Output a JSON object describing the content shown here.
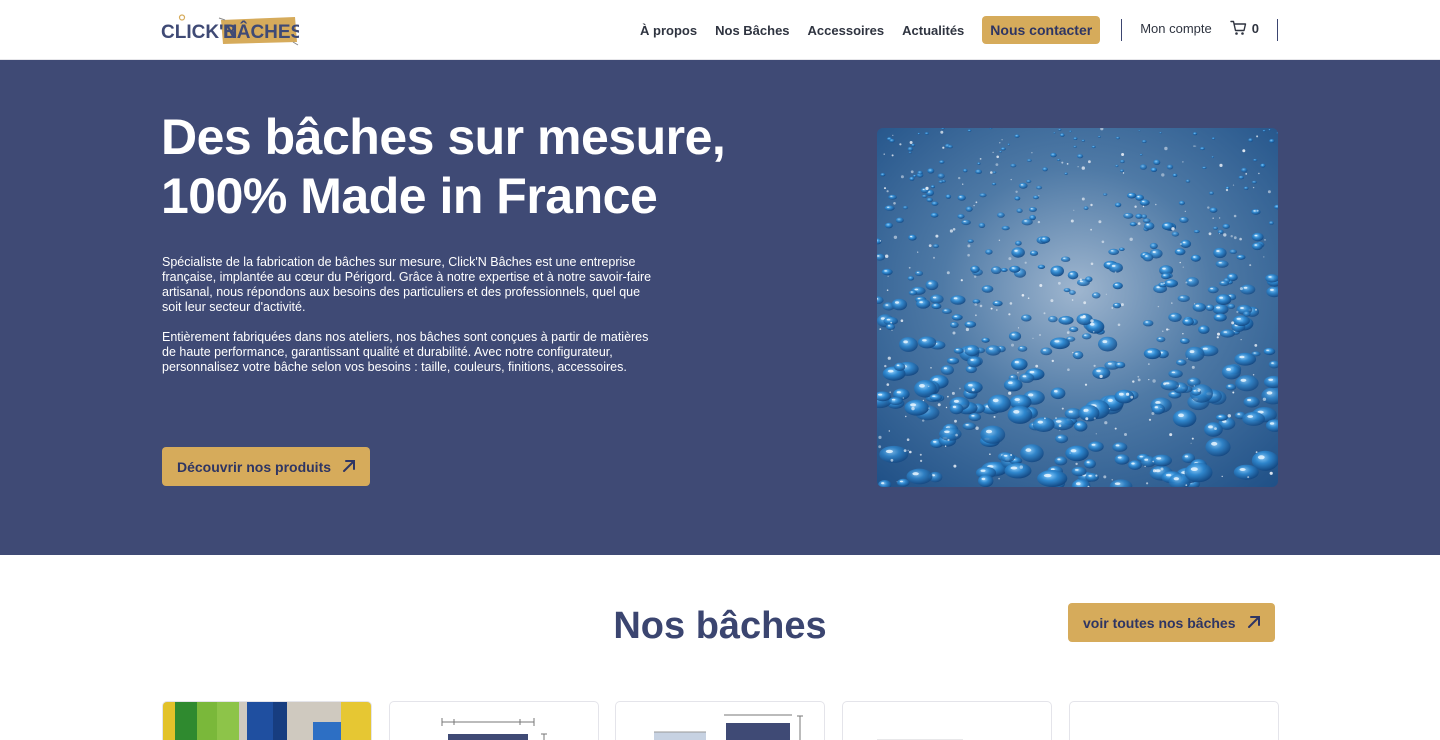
{
  "header": {
    "logo_text_1": "CLICK'N",
    "logo_text_2": "BÂCHES",
    "nav": [
      "À propos",
      "Nos Bâches",
      "Accessoires",
      "Actualités"
    ],
    "contact_label": "Nous contacter",
    "account_label": "Mon compte",
    "cart_count": "0"
  },
  "hero": {
    "title_line1": "Des bâches sur mesure,",
    "title_line2": "100% Made in France",
    "paragraph1": "Spécialiste de la fabrication de bâches sur mesure, Click'N Bâches est une entreprise française, implantée au cœur du Périgord. Grâce à notre expertise et à notre savoir-faire artisanal, nous répondons aux besoins des particuliers et des professionnels, quel que soit leur secteur d'activité.",
    "paragraph2": "Entièrement fabriquées dans nos ateliers, nos bâches sont conçues à partir de matières de haute performance, garantissant qualité et durabilité. Avec notre configurateur, personnalisez votre bâche selon vos besoins : taille, couleurs, finitions, accessoires.",
    "cta_label": "Découvrir nos produits"
  },
  "products": {
    "title": "Nos bâches",
    "all_label": "voir toutes nos bâches"
  },
  "colors": {
    "brand_blue": "#3f4a75",
    "accent_gold": "#d6ab5b",
    "dark_text": "#2e3563"
  }
}
